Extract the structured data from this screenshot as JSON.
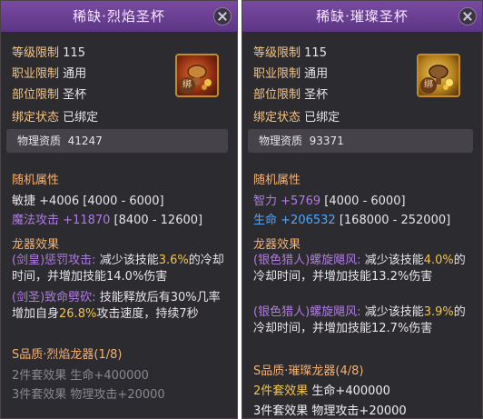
{
  "left": {
    "title": "稀缺·烈焰圣杯",
    "stats": [
      {
        "label": "等级限制",
        "value": "115"
      },
      {
        "label": "职业限制",
        "value": "通用"
      },
      {
        "label": "部位限制",
        "value": "圣杯"
      },
      {
        "label": "绑定状态",
        "value": "已绑定"
      }
    ],
    "bind_badge": "绑",
    "quality": {
      "label": "物理资质",
      "value": "41247"
    },
    "random_header": "随机属性",
    "random_attrs": [
      {
        "name": "敏捷",
        "value": "+4006",
        "range": "[4000 - 6000]"
      },
      {
        "name": "魔法攻击",
        "value": "+11870",
        "range": "[8400 - 12600]"
      }
    ],
    "dragon_header": "龙器效果",
    "effect1": {
      "tag": "(剑皇)",
      "name": "惩罚攻击:",
      "text_a": "减少该技能",
      "num": "3.6%",
      "text_b": "的冷却时间，并增加技能14.0%伤害"
    },
    "effect2": {
      "tag": "(剑圣)",
      "name": "致命劈砍:",
      "text_a": "技能释放后有30%几率增加自身",
      "num": "26.8%",
      "text_b": "攻击速度，持续7秒"
    },
    "set_title": "S品质·烈焰龙器(1/8)",
    "set_rows": [
      {
        "label": "2件套效果",
        "value": "生命+400000"
      },
      {
        "label": "3件套效果",
        "value": "物理攻击+20000"
      }
    ]
  },
  "right": {
    "title": "稀缺·璀璨圣杯",
    "stats": [
      {
        "label": "等级限制",
        "value": "115"
      },
      {
        "label": "职业限制",
        "value": "通用"
      },
      {
        "label": "部位限制",
        "value": "圣杯"
      },
      {
        "label": "绑定状态",
        "value": "已绑定"
      }
    ],
    "bind_badge": "绑",
    "quality": {
      "label": "物理资质",
      "value": "93371"
    },
    "random_header": "随机属性",
    "random_attrs": [
      {
        "name": "智力",
        "value": "+5769",
        "range": "[4000 - 6000]"
      },
      {
        "name": "生命",
        "value": "+206532",
        "range": "[168000 - 252000]"
      }
    ],
    "dragon_header": "龙器效果",
    "effect1": {
      "tag": "(银色猎人)",
      "name": "螺旋飓风:",
      "text_a": "减少该技能",
      "num": "4.0%",
      "text_b": "的冷却时间，并增加技能13.2%伤害"
    },
    "effect2": {
      "tag": "(银色猎人)",
      "name": "螺旋飓风:",
      "text_a": "减少该技能",
      "num": "3.9%",
      "text_b": "的冷却时间，并增加技能12.7%伤害"
    },
    "set_title": "S品质·璀璨龙器(4/8)",
    "set_rows": [
      {
        "label": "2件套效果",
        "value": "生命+400000"
      },
      {
        "label": "3件套效果",
        "value": "物理攻击+20000"
      }
    ]
  }
}
